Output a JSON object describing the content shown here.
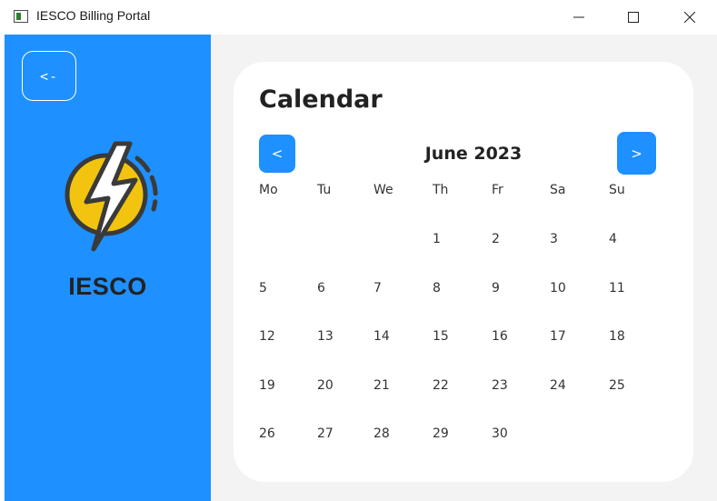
{
  "window": {
    "title": "IESCO Billing Portal",
    "controls": {
      "minimize": "—",
      "maximize": "☐",
      "close": "✕"
    }
  },
  "sidebar": {
    "back_label": "<-",
    "brand": "IESCO",
    "logo_icon": "lightning-bolt-icon",
    "background": "#1e90ff"
  },
  "calendar": {
    "title": "Calendar",
    "month_label": "June 2023",
    "prev_label": "<",
    "next_label": ">",
    "weekdays": [
      "Mo",
      "Tu",
      "We",
      "Th",
      "Fr",
      "Sa",
      "Su"
    ],
    "weeks": [
      [
        "",
        "",
        "",
        "1",
        "2",
        "3",
        "4"
      ],
      [
        "5",
        "6",
        "7",
        "8",
        "9",
        "10",
        "11"
      ],
      [
        "12",
        "13",
        "14",
        "15",
        "16",
        "17",
        "18"
      ],
      [
        "19",
        "20",
        "21",
        "22",
        "23",
        "24",
        "25"
      ],
      [
        "26",
        "27",
        "28",
        "29",
        "30",
        "",
        ""
      ]
    ],
    "accent": "#1e90ff"
  }
}
